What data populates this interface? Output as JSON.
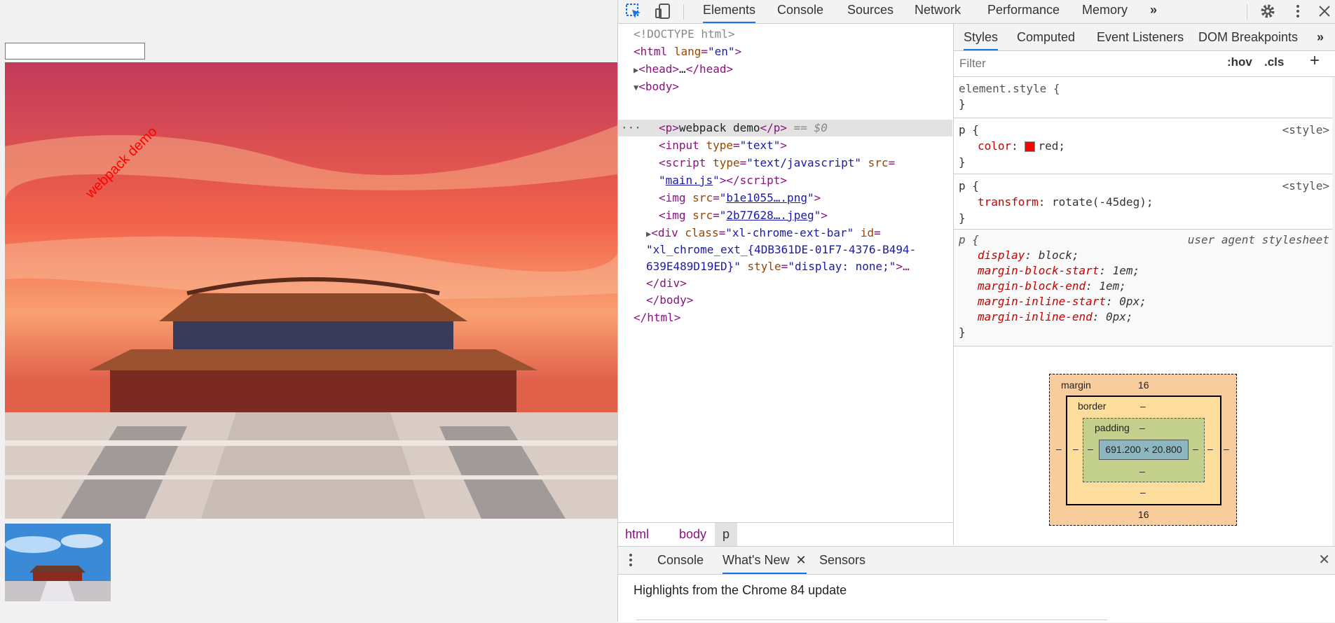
{
  "page": {
    "demo_text": "webpack demo"
  },
  "devtools": {
    "tabs": [
      "Elements",
      "Console",
      "Sources",
      "Network",
      "Performance",
      "Memory"
    ],
    "more_tabs": "»",
    "elements_lines": {
      "doctype": "<!DOCTYPE html>",
      "html_open_tag": "html",
      "html_attr": "lang",
      "html_val": "\"en\"",
      "head": "head",
      "head_ellipsis": "…",
      "body": "body",
      "p_text": "webpack demo",
      "p_eq": "== $0",
      "input_attr": "type",
      "input_val": "\"text\"",
      "script_attr1": "type",
      "script_val1": "\"text/javascript\"",
      "script_attr2": "src",
      "script_src": "main.js",
      "img1_src": "b1e1055….png",
      "img2_src": "2b77628….jpeg",
      "div_class_val": "\"xl-chrome-ext-bar\"",
      "div_id_line": "\"xl_chrome_ext_{4DB361DE-01F7-4376-B494-",
      "div_id_line2": "639E489D19ED}\"",
      "div_style_val": "\"display: none;\"",
      "div_close": "</div>",
      "body_close": "</body>",
      "html_close": "</html>"
    },
    "breadcrumb": [
      "html",
      "body",
      "p"
    ],
    "styles_tabs": [
      "Styles",
      "Computed",
      "Event Listeners",
      "DOM Breakpoints"
    ],
    "filter_placeholder": "Filter",
    "hov": ":hov",
    "cls": ".cls",
    "rules": {
      "element_style": "element.style {",
      "close_brace": "}",
      "p_selector": "p {",
      "style_source": "<style>",
      "color_prop": "color",
      "color_val": "red;",
      "transform_prop": "transform",
      "transform_val": "rotate(-45deg);",
      "ua_source": "user agent stylesheet",
      "ua_props": [
        {
          "prop": "display",
          "val": "block;"
        },
        {
          "prop": "margin-block-start",
          "val": "1em;"
        },
        {
          "prop": "margin-block-end",
          "val": "1em;"
        },
        {
          "prop": "margin-inline-start",
          "val": "0px;"
        },
        {
          "prop": "margin-inline-end",
          "val": "0px;"
        }
      ]
    },
    "box_model": {
      "margin_label": "margin",
      "margin_top": "16",
      "margin_bottom": "16",
      "border_label": "border",
      "padding_label": "padding",
      "dash": "–",
      "content": "691.200 × 20.800"
    },
    "drawer": {
      "tabs": [
        "Console",
        "What's New",
        "Sensors"
      ],
      "highlights": "Highlights from the Chrome 84 update"
    }
  },
  "colors": {
    "accent": "#1a73e8",
    "tag": "#881280",
    "attr": "#994500",
    "value": "#1a1aa6",
    "prop": "#c80000",
    "swatch_red": "#ff0000"
  }
}
